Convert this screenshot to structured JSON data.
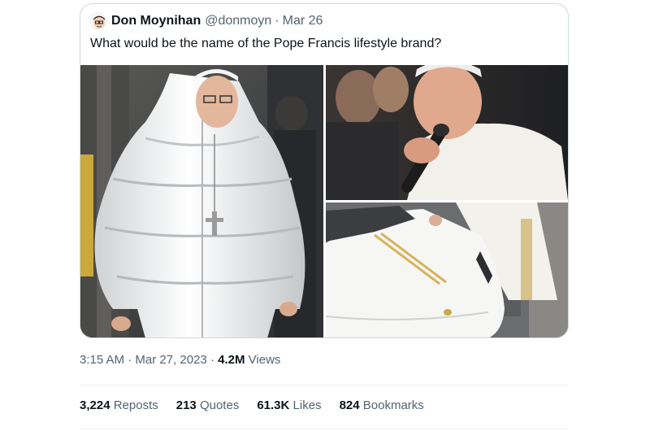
{
  "quoted_tweet": {
    "display_name": "Don Moynihan",
    "handle": "@donmoyn",
    "separator": "·",
    "date": "Mar 26",
    "text": "What would be the name of the Pope Francis lifestyle brand?",
    "media": [
      {
        "icon": "image-pope-white-puffer-coat"
      },
      {
        "icon": "image-pope-microphone"
      },
      {
        "icon": "image-pope-white-sports-car"
      }
    ]
  },
  "tweet_meta": {
    "time": "3:15 AM",
    "separator": "·",
    "date": "Mar 27, 2023",
    "views_count": "4.2M",
    "views_label": "Views"
  },
  "stats": [
    {
      "count": "3,224",
      "label": "Reposts"
    },
    {
      "count": "213",
      "label": "Quotes"
    },
    {
      "count": "61.3K",
      "label": "Likes"
    },
    {
      "count": "824",
      "label": "Bookmarks"
    }
  ],
  "colors": {
    "text_primary": "#0f1419",
    "text_secondary": "#536471",
    "border": "#cfd9de",
    "divider": "#eff3f4"
  }
}
